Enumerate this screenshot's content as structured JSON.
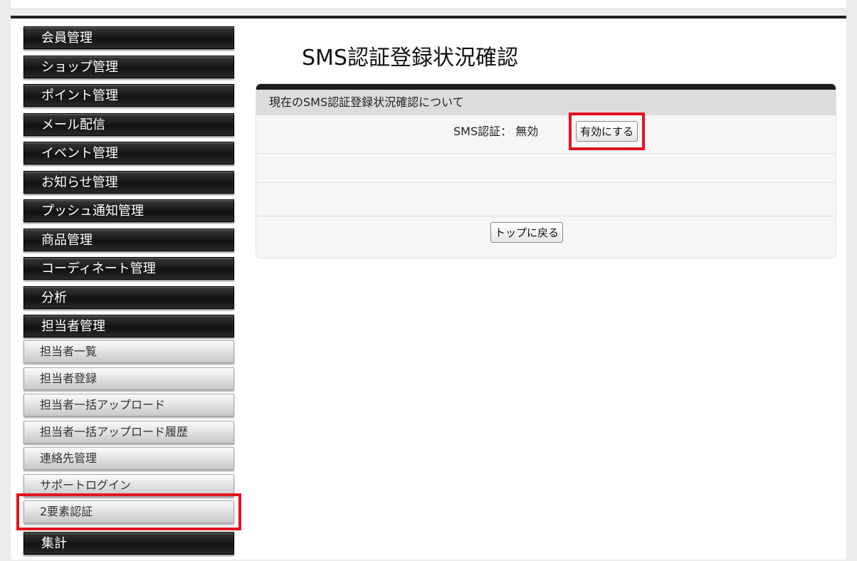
{
  "sidebar": {
    "main_items": [
      "会員管理",
      "ショップ管理",
      "ポイント管理",
      "メール配信",
      "イベント管理",
      "お知らせ管理",
      "プッシュ通知管理",
      "商品管理",
      "コーディネート管理",
      "分析",
      "担当者管理"
    ],
    "sub_items": [
      "担当者一覧",
      "担当者登録",
      "担当者一括アップロード",
      "担当者一括アップロード履歴",
      "連絡先管理",
      "サポートログイン",
      "2要素認証"
    ],
    "next_item": "集計"
  },
  "main": {
    "title": "SMS認証登録状況確認",
    "panel_header": "現在のSMS認証登録状況確認について",
    "sms_label": "SMS認証：",
    "sms_status": "無効",
    "enable_button": "有効にする",
    "back_button": "トップに戻る"
  },
  "colors": {
    "highlight": "#e3141f",
    "nav_dark": "#1a1a1a"
  }
}
